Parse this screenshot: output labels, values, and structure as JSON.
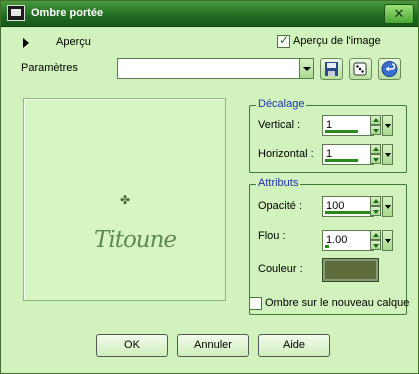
{
  "window": {
    "title": "Ombre portée",
    "close_glyph": "✕"
  },
  "preview_toggle": {
    "label": "Aperçu"
  },
  "preview_checkbox": {
    "label": "Aperçu de l'image",
    "checked": true
  },
  "settings": {
    "label": "Paramètres",
    "value": ""
  },
  "preview_image": {
    "signature": "Titoune",
    "clover": "✤"
  },
  "decalage": {
    "title": "Décalage",
    "vertical_label": "Vertical :",
    "vertical_value": "1",
    "horizontal_label": "Horizontal :",
    "horizontal_value": "1"
  },
  "attributs": {
    "title": "Attributs",
    "opacite_label": "Opacité :",
    "opacite_value": "100",
    "flou_label": "Flou :",
    "flou_value": "1.00",
    "couleur_label": "Couleur :",
    "couleur_hex": "#5e6b3a"
  },
  "new_layer": {
    "label": "Ombre sur le nouveau calque",
    "checked": false
  },
  "buttons": {
    "ok": "OK",
    "cancel": "Annuler",
    "help": "Aide"
  }
}
